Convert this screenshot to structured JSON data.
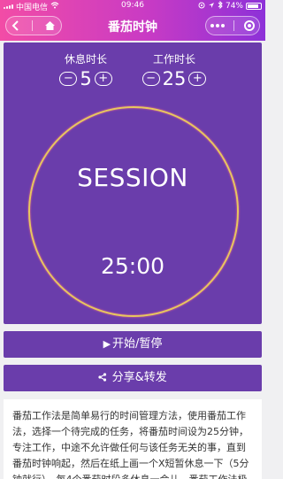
{
  "status_bar": {
    "carrier": "中国电信",
    "time": "09:46",
    "battery": "74%"
  },
  "nav": {
    "title": "番茄时钟",
    "back_icon": "back-icon",
    "home_icon": "home-icon",
    "more_icon": "more-icon",
    "close_icon": "target-icon"
  },
  "settings": {
    "break": {
      "label": "休息时长",
      "value": "5",
      "minus": "−",
      "plus": "+"
    },
    "work": {
      "label": "工作时长",
      "value": "25",
      "minus": "−",
      "plus": "+"
    }
  },
  "timer": {
    "mode": "SESSION",
    "time": "25:00"
  },
  "buttons": {
    "start": {
      "icon": "▶",
      "label": "开始/暂停"
    },
    "share": {
      "icon": "share-icon",
      "label": "分享&转发"
    }
  },
  "description": "番茄工作法是简单易行的时间管理方法，使用番茄工作法，选择一个待完成的任务，将番茄时间设为25分钟，专注工作，中途不允许做任何与该任务无关的事，直到番茄时钟响起，然后在纸上画一个X短暂休息一下（5分钟就行），每4个番茄时段多休息一会儿。番茄工作法极",
  "colors": {
    "header_start": "#f24ca6",
    "header_end": "#8d31d8",
    "panel": "#6a3dab",
    "ring": "#e8c75e",
    "background": "#f0f0f2"
  }
}
